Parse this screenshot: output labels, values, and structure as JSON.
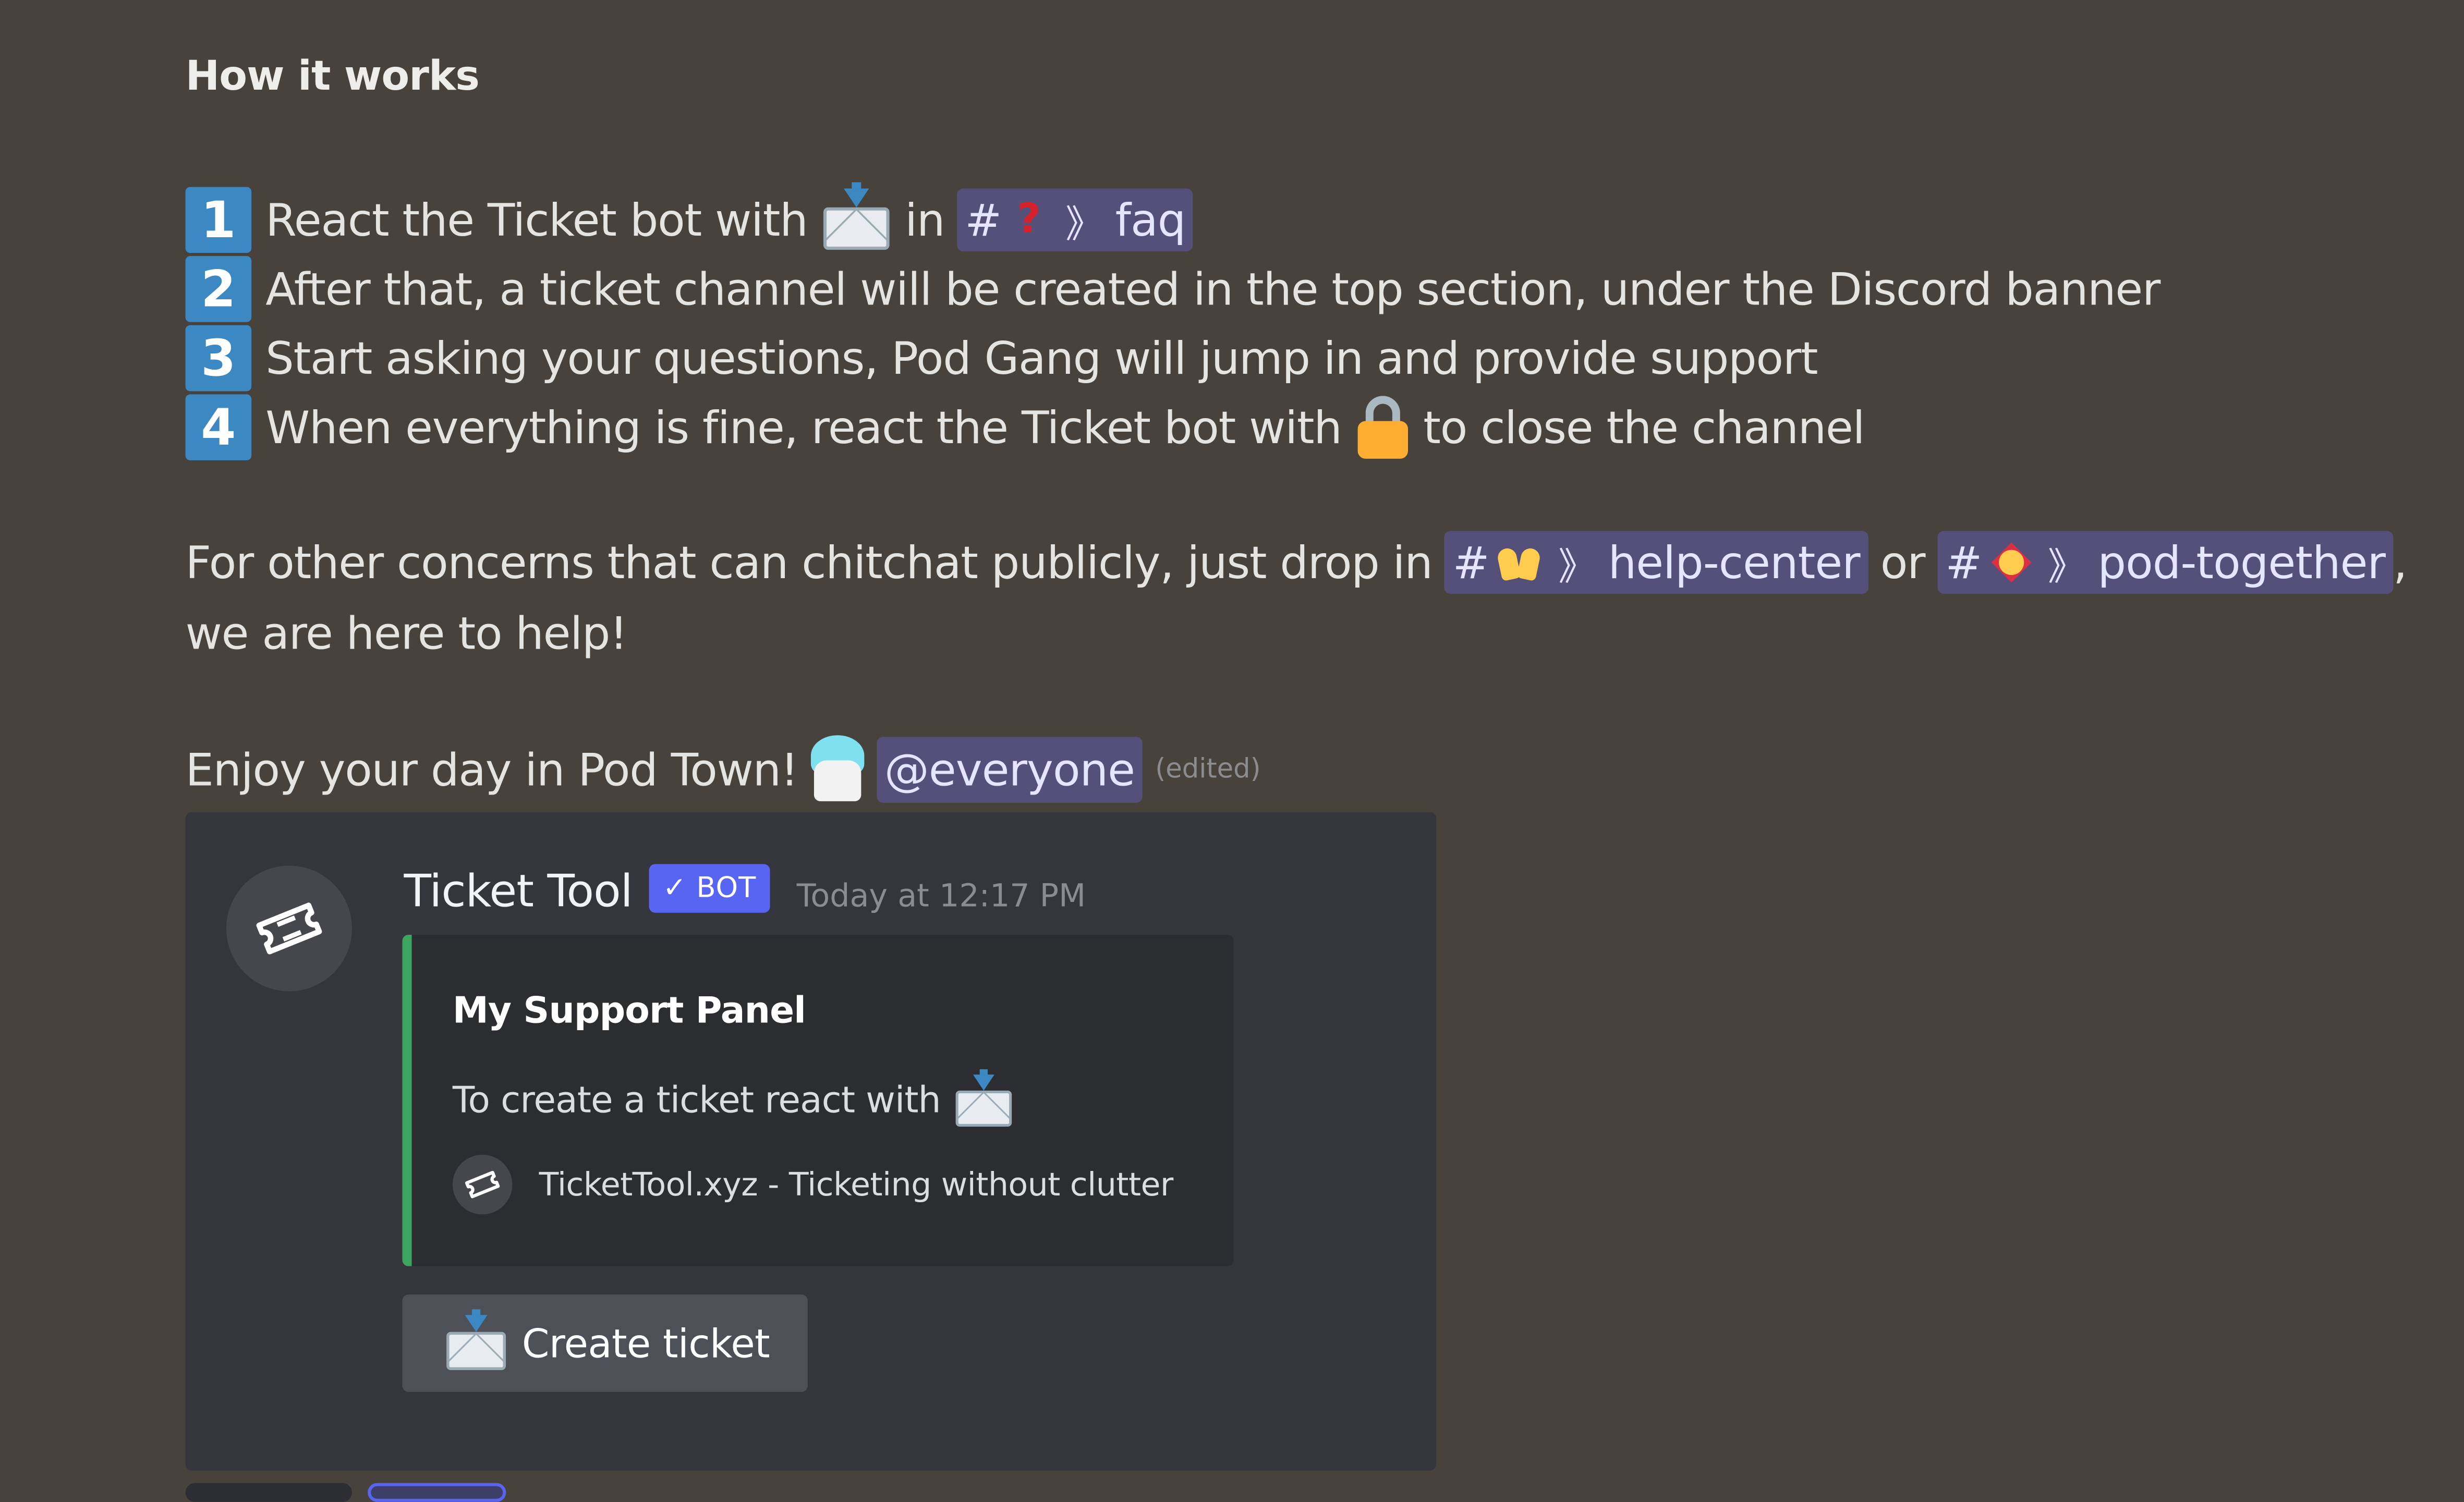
{
  "message": {
    "heading": "How it works",
    "steps": [
      {
        "num": "1",
        "text_before": "React the Ticket bot with",
        "text_mid": "in",
        "channel": "faq"
      },
      {
        "num": "2",
        "text": "After that, a ticket channel will be created in the top section, under the Discord banner"
      },
      {
        "num": "3",
        "text": "Start asking your questions, Pod Gang will jump in and provide support"
      },
      {
        "num": "4",
        "text_before": "When everything is fine, react the Ticket bot with",
        "text_after": "to close the channel"
      }
    ],
    "concerns_before": "For other concerns that can chitchat publicly, just drop in",
    "help_channel": "help-center",
    "or": "or",
    "pod_channel": "pod-together",
    "comma": ",",
    "concerns_end": "we are here to help!",
    "enjoy": "Enjoy your day in Pod Town!",
    "mention": "@everyone",
    "edited": "(edited)",
    "hash": "#",
    "chevron": "》"
  },
  "bot_message": {
    "author": "Ticket Tool",
    "tag": "✓ BOT",
    "timestamp": "Today at 12:17 PM",
    "embed": {
      "title": "My Support Panel",
      "description": "To create a ticket react with",
      "footer": "TicketTool.xyz - Ticketing without clutter",
      "accent": "#3ba55d"
    },
    "button_label": "Create ticket"
  },
  "colors": {
    "background": "#48423d",
    "card": "#35363c",
    "mention_bg": "#54507a",
    "bot_tag": "#5865f2",
    "number_badge": "#3b88c3"
  }
}
